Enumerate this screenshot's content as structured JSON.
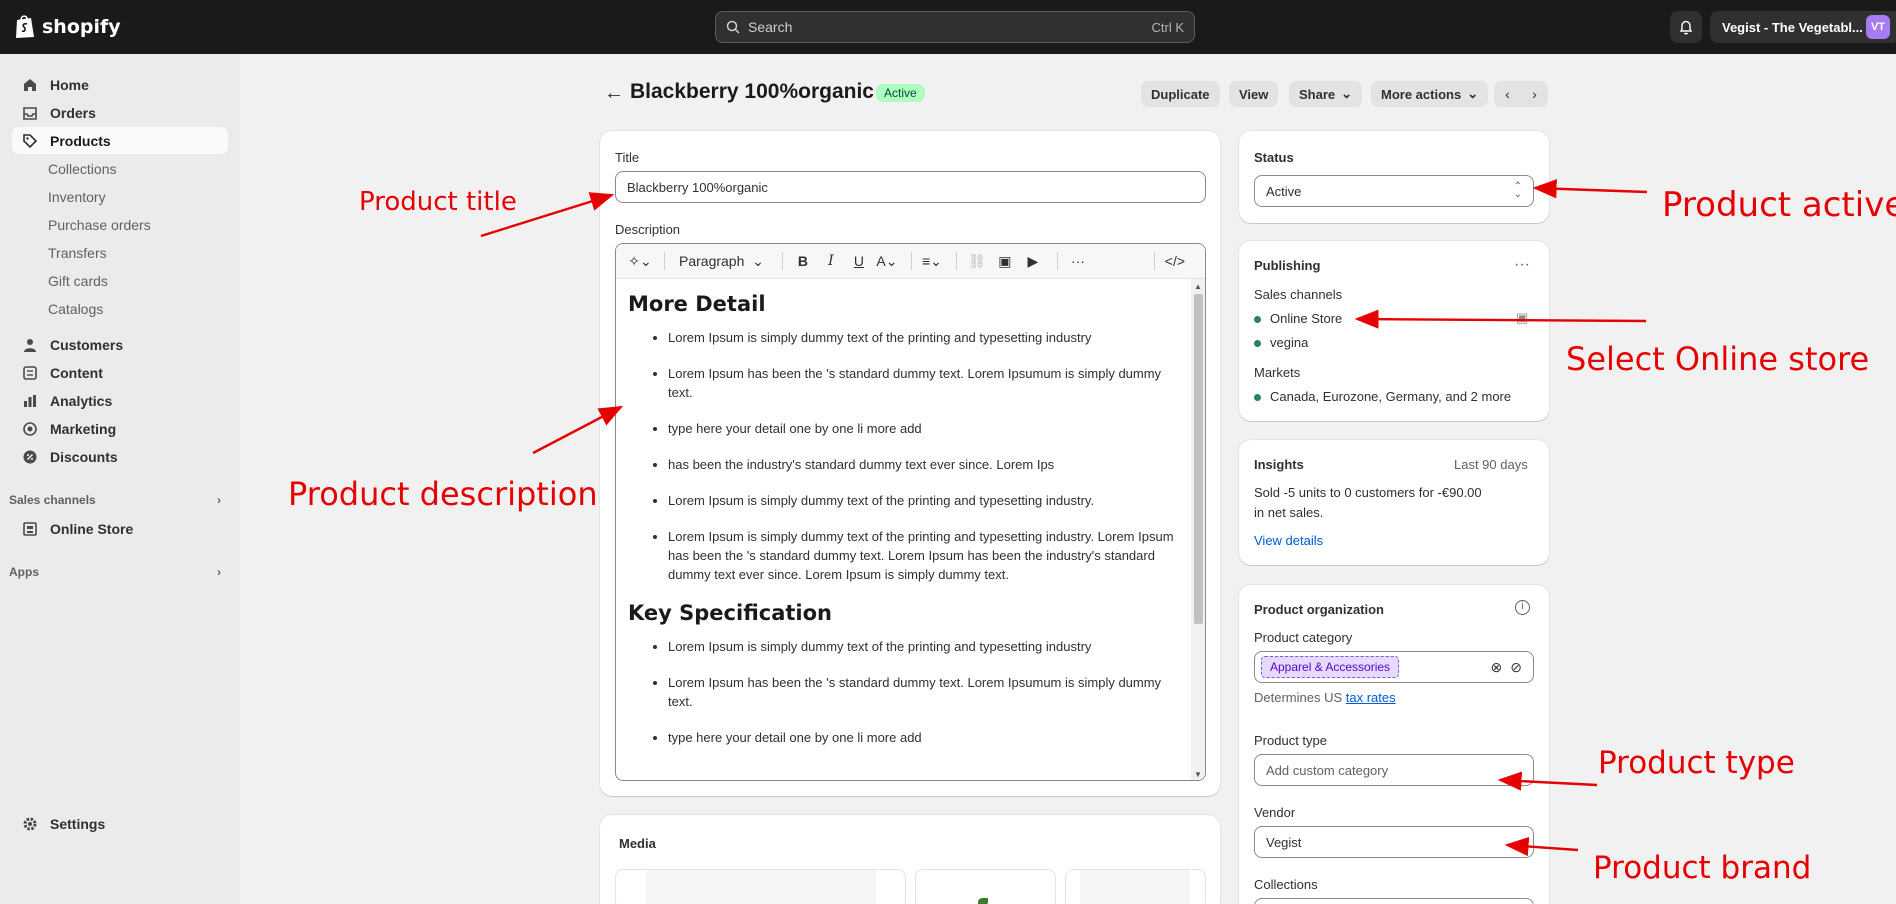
{
  "topbar": {
    "logo_text": "shopify",
    "search_placeholder": "Search",
    "search_shortcut": "Ctrl K",
    "store_name": "Vegist - The Vegetabl...",
    "avatar_initials": "VT"
  },
  "sidebar": {
    "items": [
      {
        "label": "Home",
        "icon": "home-icon"
      },
      {
        "label": "Orders",
        "icon": "inbox-icon"
      },
      {
        "label": "Products",
        "icon": "tag-icon",
        "active": true
      }
    ],
    "product_sub": [
      "Collections",
      "Inventory",
      "Purchase orders",
      "Transfers",
      "Gift cards",
      "Catalogs"
    ],
    "items2": [
      {
        "label": "Customers",
        "icon": "person-icon"
      },
      {
        "label": "Content",
        "icon": "content-icon"
      },
      {
        "label": "Analytics",
        "icon": "chart-icon"
      },
      {
        "label": "Marketing",
        "icon": "target-icon"
      },
      {
        "label": "Discounts",
        "icon": "discount-icon"
      }
    ],
    "sales_channels_label": "Sales channels",
    "online_store": "Online Store",
    "apps_label": "Apps",
    "settings": "Settings"
  },
  "header": {
    "title": "Blackberry 100%organic",
    "status_badge": "Active",
    "buttons": {
      "duplicate": "Duplicate",
      "view": "View",
      "share": "Share",
      "more_actions": "More actions"
    }
  },
  "product": {
    "title_label": "Title",
    "title_value": "Blackberry 100%organic",
    "description_label": "Description",
    "toolbar_paragraph": "Paragraph",
    "description": {
      "heading1": "More Detail",
      "list1": [
        "Lorem Ipsum is simply dummy text of the printing and typesetting industry",
        "Lorem Ipsum has been the 's standard dummy text. Lorem Ipsumum is simply dummy text.",
        "type here your detail one by one li more add",
        "has been the industry's standard dummy text ever since. Lorem Ips",
        "Lorem Ipsum is simply dummy text of the printing and typesetting industry.",
        "Lorem Ipsum is simply dummy text of the printing and typesetting industry. Lorem Ipsum has been the 's standard dummy text. Lorem Ipsum has been the industry's standard dummy text ever since. Lorem Ipsum is simply dummy text."
      ],
      "heading2": "Key Specification",
      "list2": [
        "Lorem Ipsum is simply dummy text of the printing and typesetting industry",
        "Lorem Ipsum has been the 's standard dummy text. Lorem Ipsumum is simply dummy text.",
        "type here your detail one by one li more add"
      ]
    },
    "media_label": "Media"
  },
  "status_card": {
    "label": "Status",
    "value": "Active"
  },
  "publishing": {
    "label": "Publishing",
    "sales_channels_label": "Sales channels",
    "channels": [
      "Online Store",
      "vegina"
    ],
    "markets_label": "Markets",
    "markets_value": "Canada, Eurozone, Germany, and 2 more"
  },
  "insights": {
    "label": "Insights",
    "period": "Last 90 days",
    "line1": "Sold -5 units to 0 customers for -€90.00",
    "line2": "in net sales.",
    "link": "View details"
  },
  "organization": {
    "label": "Product organization",
    "category_label": "Product category",
    "category_value": "Apparel & Accessories",
    "determines_text": "Determines US",
    "tax_link": "tax rates",
    "type_label": "Product type",
    "type_placeholder": "Add custom category",
    "vendor_label": "Vendor",
    "vendor_value": "Vegist",
    "collections_label": "Collections"
  },
  "annotations": {
    "product_title": "Product title",
    "product_description": "Product description",
    "product_active": "Product active",
    "select_online_store": "Select Online store",
    "product_type": "Product type",
    "product_brand": "Product brand"
  },
  "colors": {
    "topbar": "#1a1a1a",
    "annotation": "#e60000",
    "active_badge": "#affebf",
    "link": "#005bd3"
  }
}
